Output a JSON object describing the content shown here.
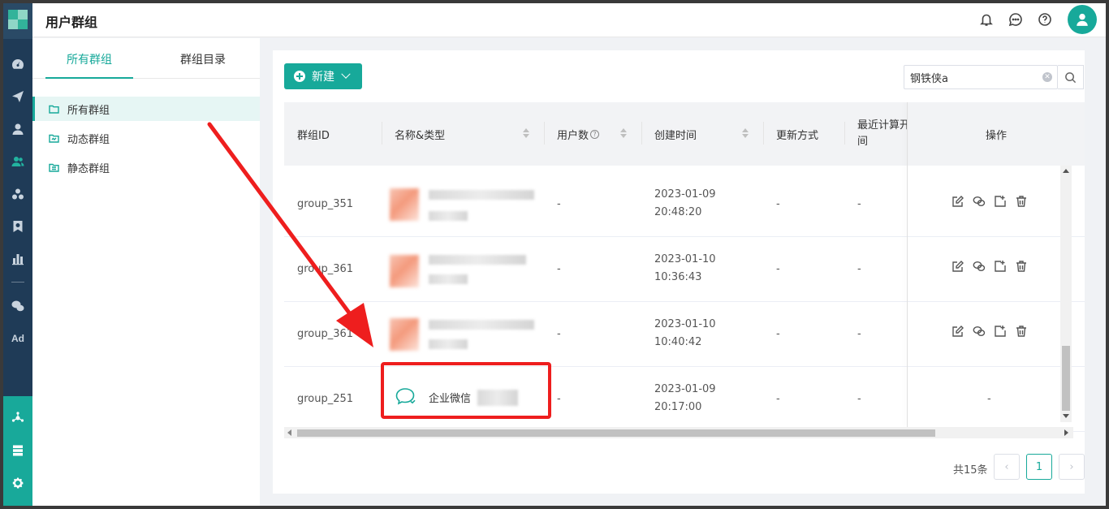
{
  "header": {
    "title": "用户群组"
  },
  "rail": {
    "icons": [
      "dashboard-icon",
      "send-icon",
      "user-icon",
      "user-group-icon",
      "cluster-icon",
      "badge-icon",
      "bar-chart-icon",
      "wechat-icon",
      "ad-icon",
      "network-icon",
      "server-icon",
      "settings-icon"
    ],
    "ad_label": "Ad"
  },
  "side": {
    "tabs": [
      {
        "label": "所有群组"
      },
      {
        "label": "群组目录"
      }
    ],
    "items": [
      {
        "label": "所有群组"
      },
      {
        "label": "动态群组"
      },
      {
        "label": "静态群组"
      }
    ]
  },
  "toolbar": {
    "new_label": "新建",
    "search_value": "钢铁侠a"
  },
  "table": {
    "columns": [
      "群组ID",
      "名称&类型",
      "用户数",
      "创建时间",
      "更新方式",
      "最近计算开",
      "间",
      "操作"
    ],
    "rows": [
      {
        "id": "group_351",
        "users": "-",
        "date": "2023-01-09",
        "time": "20:48:20",
        "update": "-",
        "last": "-"
      },
      {
        "id": "group_361",
        "users": "-",
        "date": "2023-01-10",
        "time": "10:36:43",
        "update": "-",
        "last": "-"
      },
      {
        "id": "group_361",
        "users": "-",
        "date": "2023-01-10",
        "time": "10:40:42",
        "update": "-",
        "last": "-"
      },
      {
        "id": "group_251",
        "name": "企业微信",
        "users": "-",
        "date": "2023-01-09",
        "time": "20:17:00",
        "update": "-",
        "last": "-",
        "ops": "-"
      }
    ]
  },
  "pagination": {
    "total": "共15条",
    "current": "1"
  },
  "colors": {
    "accent": "#17a99a",
    "annotation": "#ee1e1e"
  }
}
